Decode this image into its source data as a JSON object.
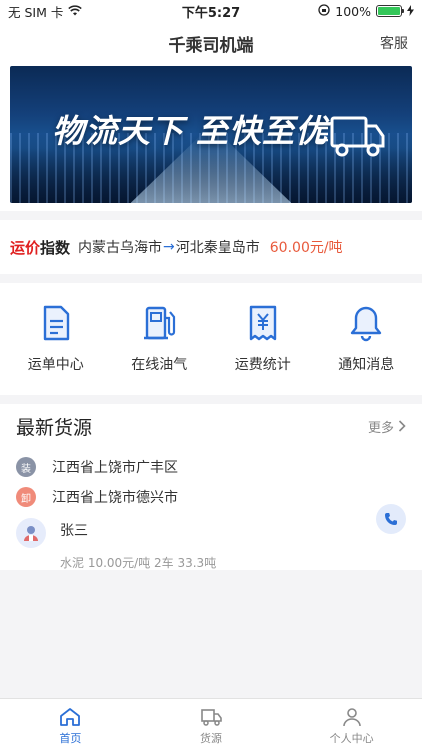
{
  "status_bar": {
    "carrier": "无 SIM 卡",
    "time": "下午5:27",
    "battery": "100%",
    "battery_level": 1.0
  },
  "nav": {
    "title": "千乘司机端",
    "service": "客服"
  },
  "banner": {
    "text": "物流天下 至快至优"
  },
  "freight_index": {
    "logo_red": "运价",
    "logo_dark": "指数",
    "from": "内蒙古乌海市",
    "arrow": "→",
    "to": "河北秦皇岛市",
    "price": "60.00元/吨"
  },
  "menu": {
    "items": [
      {
        "label": "运单中心",
        "icon": "document-icon"
      },
      {
        "label": "在线油气",
        "icon": "fuel-pump-icon"
      },
      {
        "label": "运费统计",
        "icon": "yen-receipt-icon"
      },
      {
        "label": "通知消息",
        "icon": "bell-icon"
      }
    ]
  },
  "cargo": {
    "title": "最新货源",
    "more": "更多",
    "load_badge": "装",
    "load_address": "江西省上饶市广丰区",
    "unload_badge": "卸",
    "unload_address": "江西省上饶市德兴市",
    "driver_name": "张三",
    "detail": "水泥 10.00元/吨 2车 33.3吨"
  },
  "tabs": [
    {
      "label": "首页",
      "icon": "home-icon",
      "active": true
    },
    {
      "label": "货源",
      "icon": "truck-box-icon",
      "active": false
    },
    {
      "label": "个人中心",
      "icon": "person-icon",
      "active": false
    }
  ],
  "colors": {
    "accent": "#2b6fd6",
    "price": "#e85a3c",
    "red": "#e02020"
  }
}
